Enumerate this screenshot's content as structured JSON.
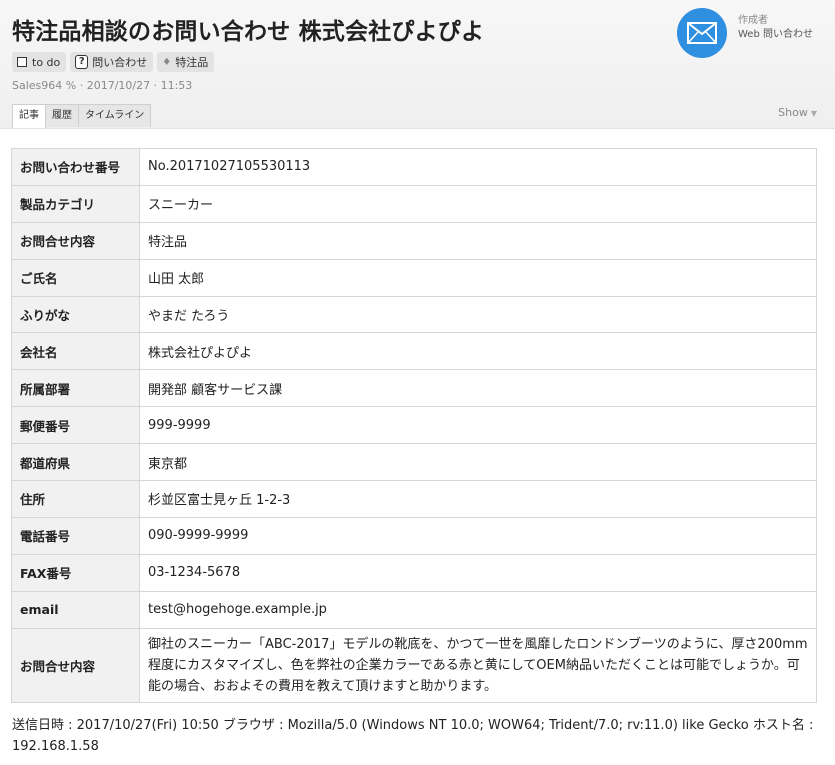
{
  "header": {
    "title": "特注品相談のお問い合わせ 株式会社ぴよぴよ",
    "tags": {
      "todo": "to do",
      "inquiry": "問い合わせ",
      "inquiry_icon": "?",
      "special": "特注品"
    },
    "meta": "Sales964 % · 2017/10/27 · 11:53",
    "author_label": "作成者",
    "author_name": "Web 問い合わせ",
    "author_icon": "envelope-icon",
    "author_icon_color": "#2f8fe0"
  },
  "tabs": {
    "article": "記事",
    "history": "履歴",
    "timeline": "タイムライン",
    "show": "Show"
  },
  "rows": [
    {
      "label": "お問い合わせ番号",
      "value": "No.20171027105530113"
    },
    {
      "label": "製品カテゴリ",
      "value": "スニーカー"
    },
    {
      "label": "お問合せ内容",
      "value": "特注品"
    },
    {
      "label": "ご氏名",
      "value": "山田 太郎"
    },
    {
      "label": "ふりがな",
      "value": "やまだ たろう"
    },
    {
      "label": "会社名",
      "value": "株式会社ぴよぴよ"
    },
    {
      "label": "所属部署",
      "value": "開発部 顧客サービス課"
    },
    {
      "label": "郵便番号",
      "value": "999-9999"
    },
    {
      "label": "都道府県",
      "value": "東京都"
    },
    {
      "label": "住所",
      "value": "杉並区富士見ヶ丘 1-2-3"
    },
    {
      "label": "電話番号",
      "value": "090-9999-9999"
    },
    {
      "label": "FAX番号",
      "value": "03-1234-5678"
    },
    {
      "label": "email",
      "value": "test@hogehoge.example.jp"
    },
    {
      "label": "お問合せ内容",
      "value": "御社のスニーカー「ABC-2017」モデルの靴底を、かつて一世を風靡したロンドンブーツのように、厚さ200mm程度にカスタマイズし、色を弊社の企業カラーである赤と黄にしてOEM納品いただくことは可能でしょうか。可能の場合、おおよその費用を教えて頂けますと助かります。"
    }
  ],
  "footer": {
    "text": "送信日時 : 2017/10/27(Fri) 10:50 ブラウザ : Mozilla/5.0 (Windows NT 10.0; WOW64; Trident/7.0; rv:11.0) like Gecko ホスト名 : 192.168.1.58"
  }
}
